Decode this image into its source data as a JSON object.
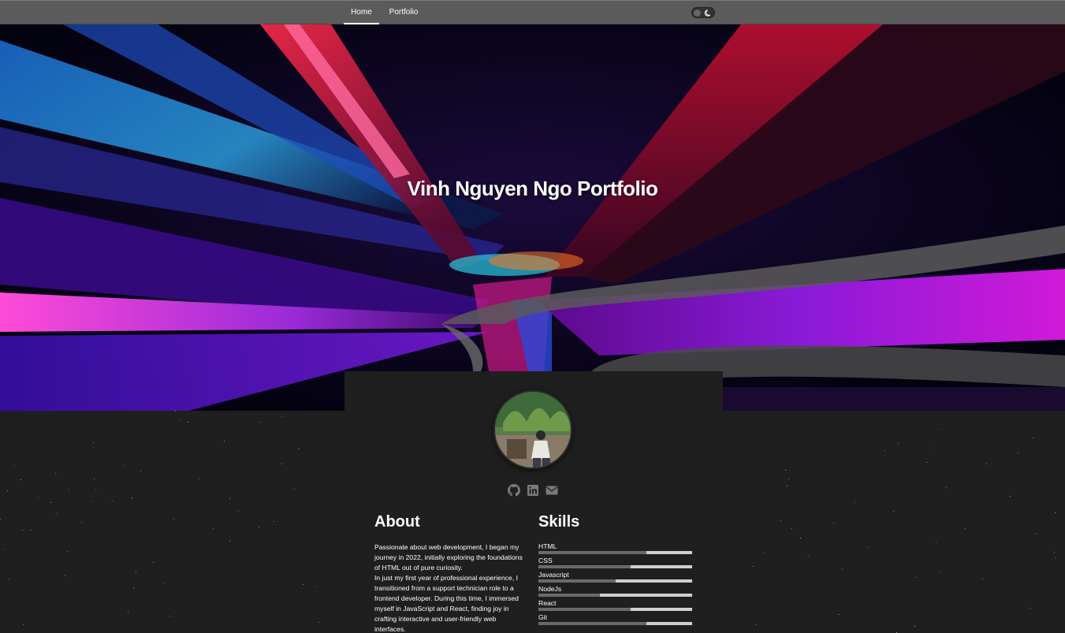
{
  "nav": {
    "home": "Home",
    "portfolio": "Portfolio"
  },
  "theme_toggle": {
    "icon": "moon-icon",
    "mode": "dark"
  },
  "hero": {
    "title": "Vinh Nguyen Ngo Portfolio"
  },
  "profile": {
    "avatar_alt": "profile-photo",
    "social": [
      {
        "icon": "github-icon"
      },
      {
        "icon": "linkedin-icon"
      },
      {
        "icon": "email-icon"
      }
    ]
  },
  "about": {
    "heading": "About",
    "paragraph_1": "Passionate about web development, I began my journey in 2022, initially exploring the foundations of HTML out of pure curiosity.",
    "paragraph_2": "In just my first year of professional experience, I transitioned from a support technician role to a frontend developer. During this time, I immersed myself in JavaScript and React, finding joy in crafting interactive and user-friendly web interfaces."
  },
  "skills": {
    "heading": "Skills",
    "items": [
      {
        "label": "HTML",
        "level": 0.7
      },
      {
        "label": "CSS",
        "level": 0.6
      },
      {
        "label": "Javascript",
        "level": 0.5
      },
      {
        "label": "NodeJs",
        "level": 0.4
      },
      {
        "label": "React",
        "level": 0.6
      },
      {
        "label": "Git",
        "level": 0.7
      }
    ]
  },
  "colors": {
    "navbar": "#5b5b5b",
    "page_bg": "#1f1f1f",
    "skill_track": "#cfcfcf",
    "skill_fill": "#6a6a6a"
  }
}
